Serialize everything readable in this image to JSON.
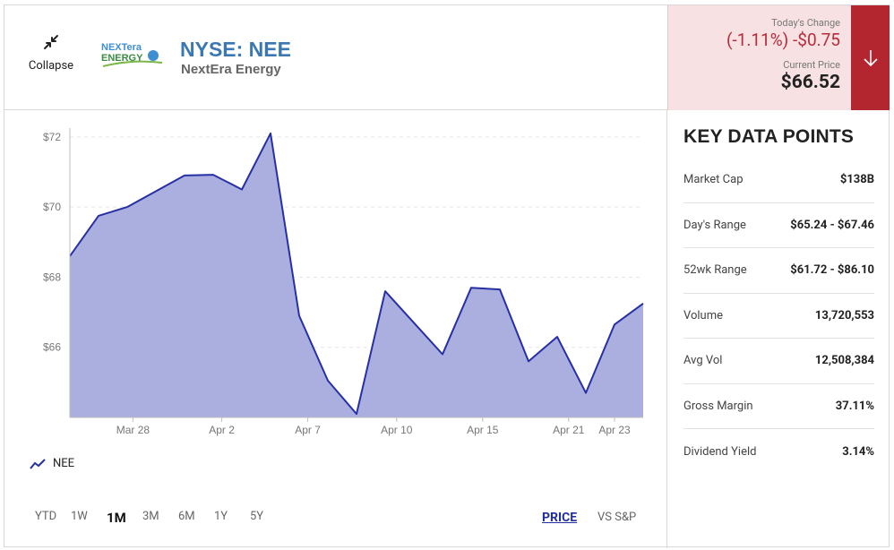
{
  "header": {
    "collapse_label": "Collapse",
    "logo_text_top": "NEXTera",
    "logo_text_bottom": "ENERGY",
    "ticker": "NYSE: NEE",
    "company": "NextEra Energy"
  },
  "quote": {
    "change_label": "Today's Change",
    "change_value": "(-1.11%) -$0.75",
    "price_label": "Current Price",
    "price_value": "$66.52",
    "down_color": "#b82b3a"
  },
  "key_data": {
    "title": "KEY DATA POINTS",
    "items": [
      {
        "label": "Market Cap",
        "value": "$138B"
      },
      {
        "label": "Day's Range",
        "value": "$65.24 - $67.46"
      },
      {
        "label": "52wk Range",
        "value": "$61.72 - $86.10"
      },
      {
        "label": "Volume",
        "value": "13,720,553"
      },
      {
        "label": "Avg Vol",
        "value": "12,508,384"
      },
      {
        "label": "Gross Margin",
        "value": "37.11%"
      },
      {
        "label": "Dividend Yield",
        "value": "3.14%"
      }
    ]
  },
  "controls": {
    "ranges": [
      "YTD",
      "1W",
      "1M",
      "3M",
      "6M",
      "1Y",
      "5Y"
    ],
    "active_range": "1M",
    "mode_price": "PRICE",
    "mode_vs": "VS S&P"
  },
  "chart_data": {
    "type": "area",
    "series": [
      {
        "name": "NEE",
        "color": "#2630a3",
        "fill": "#abafe0",
        "values": [
          68.6,
          69.75,
          70.0,
          70.45,
          70.9,
          70.92,
          70.5,
          72.1,
          66.9,
          65.05,
          64.1,
          67.6,
          66.7,
          65.8,
          67.7,
          67.65,
          65.6,
          66.3,
          64.7,
          66.65,
          67.25
        ]
      }
    ],
    "x_tick_labels": [
      "Mar 28",
      "Apr 2",
      "Apr 7",
      "Apr 10",
      "Apr 15",
      "Apr 21",
      "Apr 23"
    ],
    "x_tick_index": [
      2.2,
      5.3,
      8.3,
      11.4,
      14.4,
      17.4,
      19.0
    ],
    "y_ticks": [
      66,
      68,
      70,
      72
    ],
    "y_tick_labels": [
      "$66",
      "$68",
      "$70",
      "$72"
    ],
    "ylim": [
      64.0,
      72.2
    ],
    "grid": "horizontal-dashed",
    "legend": "bottom-left"
  }
}
